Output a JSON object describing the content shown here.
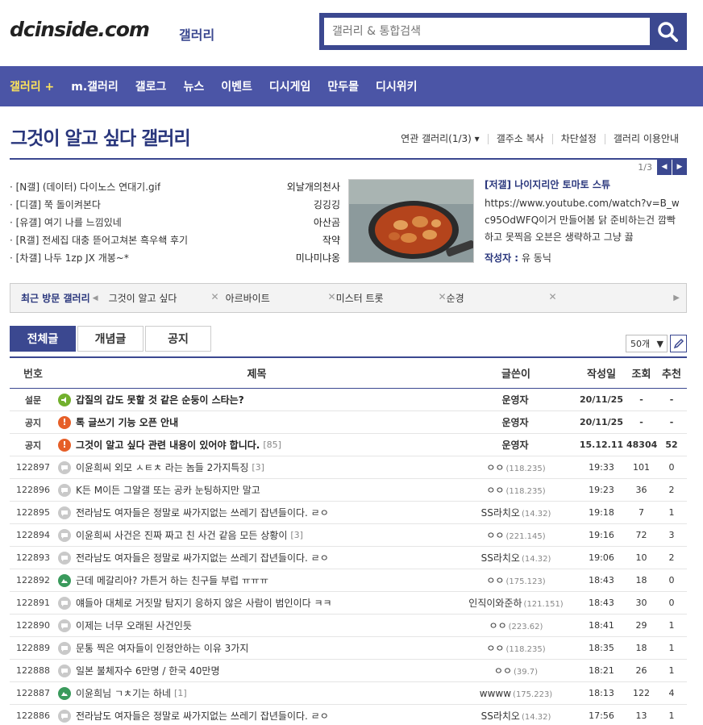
{
  "header": {
    "logo": "dcinside.com",
    "logo_sub": "갤러리",
    "search_placeholder": "갤러리 & 통합검색"
  },
  "nav": [
    "갤러리 +",
    "m.갤러리",
    "갤로그",
    "뉴스",
    "이벤트",
    "디시게임",
    "만두몰",
    "디시위키"
  ],
  "gallery": {
    "title": "그것이 알고 싶다 갤러리",
    "menu": [
      "연관 갤러리(1/3) ▾",
      "갤주소 복사",
      "차단설정",
      "갤러리 이용안내"
    ]
  },
  "concept": [
    {
      "title": "· [N갤] (데이터) 다이노스 연대기.gif",
      "author": "외날개의천사"
    },
    {
      "title": "· [디갤] 쭉 돌이켜본다",
      "author": "깅깅깅"
    },
    {
      "title": "· [유갤] 여기 나를 느낌있네",
      "author": "아산곰"
    },
    {
      "title": "· [R갤] 전세집 대충 뜯어고쳐본 흑우쇅 후기",
      "author": "작약"
    },
    {
      "title": "· [차갤] 나두 1zp JX 개봉~*",
      "author": "미나미냐옹"
    }
  ],
  "feature": {
    "title": "[저갤] 나이지리안 토마토 스튜",
    "desc": "https://www.youtube.com/watch?v=B_wc95OdWFQ이거 만들어봄 닭 준비하는건 깜빡하고 못찍음 오븐은 생략하고 그냥 끓",
    "writer_label": "작성자 :",
    "writer": "유 동닉",
    "pager": "1/3"
  },
  "recent": {
    "label": "최근 방문 갤러리",
    "items": [
      "그것이 알고 싶다",
      "아르바이트",
      "미스터 트롯",
      "순경"
    ]
  },
  "tabs": [
    "전체글",
    "개념글",
    "공지"
  ],
  "list_count": "50개",
  "columns": {
    "num": "번호",
    "title": "제목",
    "writer": "글쓴이",
    "date": "작성일",
    "views": "조회",
    "rec": "추천"
  },
  "rows": [
    {
      "num": "설문",
      "type": "sur",
      "title": "갑질의 갑도 못할 것 같은 순둥이 스타는?",
      "reply": "",
      "writer": "운영자",
      "ip": "",
      "date": "20/11/25",
      "views": "-",
      "rec": "-",
      "notice": true
    },
    {
      "num": "공지",
      "type": "ntc",
      "title": "톡 글쓰기 기능 오픈 안내",
      "reply": "",
      "writer": "운영자",
      "ip": "",
      "date": "20/11/25",
      "views": "-",
      "rec": "-",
      "notice": true
    },
    {
      "num": "공지",
      "type": "ntc",
      "title": "그것이 알고 싶다 관련 내용이 있어야 합니다.",
      "reply": "[85]",
      "writer": "운영자",
      "ip": "",
      "date": "15.12.11",
      "views": "48304",
      "rec": "52",
      "notice": true
    },
    {
      "num": "122897",
      "type": "txt",
      "title": "이윤희씨 외모 ㅅㅌㅊ 라는 놈들 2가지특징",
      "reply": "[3]",
      "writer": "ㅇㅇ",
      "ip": "(118.235)",
      "date": "19:33",
      "views": "101",
      "rec": "0",
      "notice": false
    },
    {
      "num": "122896",
      "type": "txt",
      "title": "K든 M이든 그알갤 또는 공카 눈팅하지만 말고",
      "reply": "",
      "writer": "ㅇㅇ",
      "ip": "(118.235)",
      "date": "19:23",
      "views": "36",
      "rec": "2",
      "notice": false
    },
    {
      "num": "122895",
      "type": "txt",
      "title": "전라남도 여자들은 정말로 싸가지없는 쓰레기 잡년들이다. ㄹㅇ",
      "reply": "",
      "writer": "SS라치오",
      "ip": "(14.32)",
      "date": "19:18",
      "views": "7",
      "rec": "1",
      "notice": false
    },
    {
      "num": "122894",
      "type": "txt",
      "title": "이윤희씨 사건은 진짜 짜고 친 사건 같음 모든 상황이",
      "reply": "[3]",
      "writer": "ㅇㅇ",
      "ip": "(221.145)",
      "date": "19:16",
      "views": "72",
      "rec": "3",
      "notice": false
    },
    {
      "num": "122893",
      "type": "txt",
      "title": "전라남도 여자들은 정말로 싸가지없는 쓰레기 잡년들이다. ㄹㅇ",
      "reply": "",
      "writer": "SS라치오",
      "ip": "(14.32)",
      "date": "19:06",
      "views": "10",
      "rec": "2",
      "notice": false
    },
    {
      "num": "122892",
      "type": "img",
      "title": "근데 메갈리아? 가튼거 하는 친구들 부럽 ㅠㅠㅠ",
      "reply": "",
      "writer": "ㅇㅇ",
      "ip": "(175.123)",
      "date": "18:43",
      "views": "18",
      "rec": "0",
      "notice": false
    },
    {
      "num": "122891",
      "type": "txt",
      "title": "얘들아 대체로 거짓말 탐지기 응하지 않은 사람이 범인이다 ㅋㅋ",
      "reply": "",
      "writer": "인직이와준하",
      "ip": "(121.151)",
      "date": "18:43",
      "views": "30",
      "rec": "0",
      "notice": false
    },
    {
      "num": "122890",
      "type": "txt",
      "title": "이제는 너무 오래된 사건인듯",
      "reply": "",
      "writer": "ㅇㅇ",
      "ip": "(223.62)",
      "date": "18:41",
      "views": "29",
      "rec": "1",
      "notice": false
    },
    {
      "num": "122889",
      "type": "txt",
      "title": "문통 찍은 여자들이 인정안하는 이유 3가지",
      "reply": "",
      "writer": "ㅇㅇ",
      "ip": "(118.235)",
      "date": "18:35",
      "views": "18",
      "rec": "1",
      "notice": false
    },
    {
      "num": "122888",
      "type": "txt",
      "title": "일본 불체자수 6만명 / 한국 40만명",
      "reply": "",
      "writer": "ㅇㅇ",
      "ip": "(39.7)",
      "date": "18:21",
      "views": "26",
      "rec": "1",
      "notice": false
    },
    {
      "num": "122887",
      "type": "img",
      "title": "이윤희님 ㄱㅊ기는 하네",
      "reply": "[1]",
      "writer": "wwww",
      "ip": "(175.223)",
      "date": "18:13",
      "views": "122",
      "rec": "4",
      "notice": false
    },
    {
      "num": "122886",
      "type": "txt",
      "title": "전라남도 여자들은 정말로 싸가지없는 쓰레기 잡년들이다. ㄹㅇ",
      "reply": "",
      "writer": "SS라치오",
      "ip": "(14.32)",
      "date": "17:56",
      "views": "13",
      "rec": "1",
      "notice": false
    }
  ]
}
